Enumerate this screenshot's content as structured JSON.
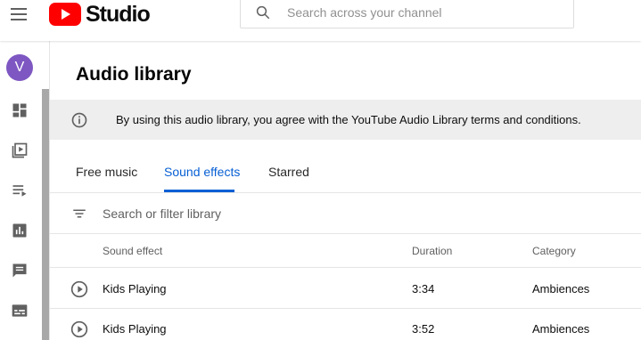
{
  "header": {
    "logo_text": "Studio",
    "search_placeholder": "Search across your channel"
  },
  "sidebar": {
    "avatar_letter": "V",
    "items": [
      {
        "icon": "dashboard-icon"
      },
      {
        "icon": "content-icon"
      },
      {
        "icon": "playlists-icon"
      },
      {
        "icon": "analytics-icon"
      },
      {
        "icon": "comments-icon"
      },
      {
        "icon": "subtitles-icon"
      }
    ]
  },
  "main": {
    "title": "Audio library",
    "banner_text": "By using this audio library, you agree with the YouTube Audio Library terms and conditions.",
    "tabs": [
      {
        "label": "Free music",
        "active": false
      },
      {
        "label": "Sound effects",
        "active": true
      },
      {
        "label": "Starred",
        "active": false
      }
    ],
    "filter_placeholder": "Search or filter library",
    "table": {
      "headers": [
        "Sound effect",
        "Duration",
        "Category"
      ],
      "rows": [
        {
          "name": "Kids Playing",
          "duration": "3:34",
          "category": "Ambiences"
        },
        {
          "name": "Kids Playing",
          "duration": "3:52",
          "category": "Ambiences"
        }
      ]
    }
  },
  "colors": {
    "accent": "#065fd4",
    "brand_red": "#ff0000",
    "avatar": "#7e57c2",
    "banner_bg": "#eeeeee"
  }
}
